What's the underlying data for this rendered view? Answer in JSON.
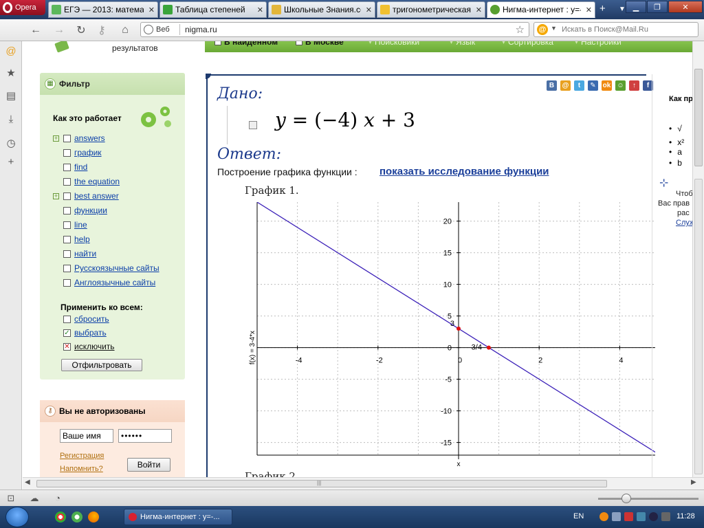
{
  "browser": {
    "menu_label": "Opera",
    "tabs": [
      {
        "label": "ЕГЭ — 2013: матема...",
        "icon": "check-icon"
      },
      {
        "label": "Таблица степеней",
        "icon": "arrow-icon"
      },
      {
        "label": "Школьные Знания.со...",
        "icon": "shield-icon"
      },
      {
        "label": "тригонометрическая...",
        "icon": "page-icon"
      },
      {
        "label": "Нигма-интернет : у=-...",
        "icon": "nigma-icon"
      }
    ],
    "address": {
      "prefix": "Веб",
      "url": "nigma.ru"
    },
    "search_placeholder": "Искать в Поиск@Mail.Ru"
  },
  "page": {
    "results_label": "результатов",
    "top_nav": [
      "В найденном",
      "В Москве",
      "Поисковики",
      "Язык",
      "Сортировка",
      "Настройки"
    ],
    "filter": {
      "title": "Фильтр",
      "how_it_works": "Как это работает",
      "items": [
        {
          "label": "answers",
          "expandable": true
        },
        {
          "label": "график",
          "expandable": false
        },
        {
          "label": "find",
          "expandable": false
        },
        {
          "label": "the equation",
          "expandable": false
        },
        {
          "label": "best answer",
          "expandable": true
        },
        {
          "label": "функции",
          "expandable": false
        },
        {
          "label": "line",
          "expandable": false
        },
        {
          "label": "help",
          "expandable": false
        },
        {
          "label": "найти",
          "expandable": false
        },
        {
          "label": "Русскоязычные сайты",
          "expandable": false
        },
        {
          "label": "Англоязычные сайты",
          "expandable": false
        }
      ],
      "apply_all_label": "Применить ко всем:",
      "apply_options": [
        {
          "label": "сбросить",
          "state": "empty"
        },
        {
          "label": "выбрать",
          "state": "checked"
        },
        {
          "label": "исключить",
          "state": "x"
        }
      ],
      "filter_button": "Отфильтровать"
    },
    "auth": {
      "title": "Вы не авторизованы",
      "name_value": "Ваше имя",
      "password_value": "••••••",
      "register_link": "Регистрация",
      "remind_link": "Напомнить?",
      "login_button": "Войти"
    },
    "result": {
      "given_label": "Дано:",
      "formula_parts": {
        "y": "y",
        "eq": " = (−4) ",
        "x": "x",
        "tail": " + 3"
      },
      "answer_label": "Ответ:",
      "build_text": "Построение графика функции :",
      "study_link": "показать исследование функции",
      "graph1_title": "График 1.",
      "graph2_title": "График 2"
    },
    "share_icons": [
      {
        "name": "vk-icon",
        "label": "B",
        "color": "#4a6fa5"
      },
      {
        "name": "mailru-icon",
        "label": "@",
        "color": "#e8a020"
      },
      {
        "name": "twitter-icon",
        "label": "t",
        "color": "#4aa8e0"
      },
      {
        "name": "livejournal-icon",
        "label": "✎",
        "color": "#3a6ab0"
      },
      {
        "name": "odnoklassniki-icon",
        "label": "ok",
        "color": "#f08a10"
      },
      {
        "name": "friends-icon",
        "label": "☺",
        "color": "#5aa030"
      },
      {
        "name": "myworld-icon",
        "label": "↑",
        "color": "#d04040"
      },
      {
        "name": "facebook-icon",
        "label": "f",
        "color": "#3b5998"
      }
    ],
    "right_column": {
      "heading": "Как пр",
      "list": [
        "√",
        "x²",
        "a",
        "b"
      ],
      "texts": [
        "Чтоб",
        "Вас прав",
        "рас"
      ],
      "link": "Служ"
    }
  },
  "chart_data": {
    "type": "line",
    "title": "",
    "xlabel": "x",
    "ylabel": "f(x) = 3-4*x",
    "xlim": [
      -5,
      5
    ],
    "ylim": [
      -17,
      23
    ],
    "xticks": [
      -4,
      -2,
      0,
      2,
      4
    ],
    "yticks": [
      -15,
      -10,
      -5,
      0,
      5,
      10,
      15,
      20
    ],
    "grid": true,
    "series": [
      {
        "x": [
          -5,
          5
        ],
        "y": [
          23,
          -17
        ],
        "color": "#3a1fb8"
      }
    ],
    "points": [
      {
        "x": 0,
        "y": 3,
        "label": "3"
      },
      {
        "x": 0.75,
        "y": 0,
        "label": "3/4"
      }
    ],
    "point_color": "#e01010"
  },
  "status": {
    "zoom_icon": "zoom-slider"
  },
  "taskbar": {
    "task_label": "Нигма-интернет : у=-...",
    "lang": "EN",
    "clock": "11:28"
  }
}
